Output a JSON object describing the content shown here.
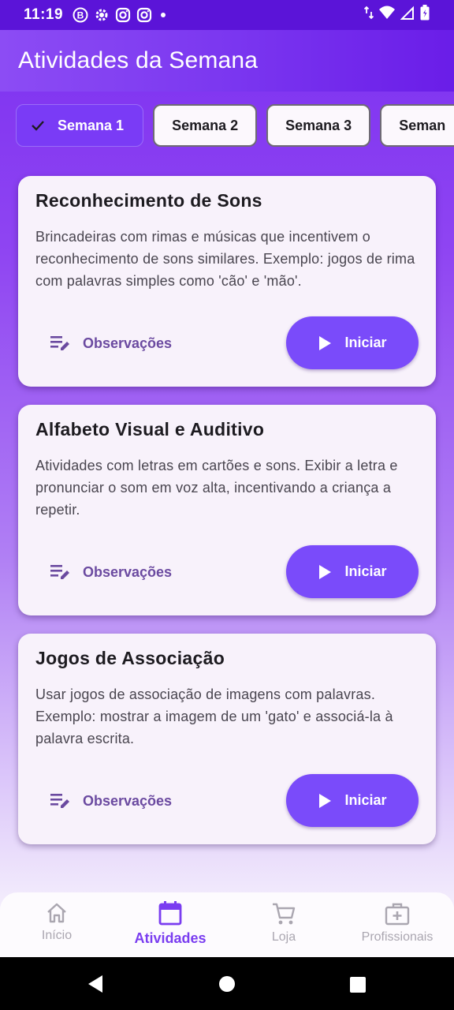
{
  "status_bar": {
    "time": "11:19",
    "icons": [
      "b-circle-icon",
      "settings-gear-icon",
      "instagram-icon",
      "instagram-icon",
      "dot-icon"
    ],
    "right_icons": [
      "data-arrows-icon",
      "wifi-icon",
      "signal-icon",
      "battery-icon"
    ]
  },
  "app_bar": {
    "title": "Atividades da Semana"
  },
  "weeks": [
    {
      "label": "Semana 1",
      "selected": true
    },
    {
      "label": "Semana 2",
      "selected": false
    },
    {
      "label": "Semana 3",
      "selected": false
    },
    {
      "label": "Seman",
      "selected": false
    }
  ],
  "activities": [
    {
      "title": "Reconhecimento de Sons",
      "description": "Brincadeiras com rimas e músicas que incentivem o reconhecimento de sons similares. Exemplo: jogos de rima com palavras simples como 'cão' e 'mão'.",
      "notes_label": "Observações",
      "start_label": "Iniciar"
    },
    {
      "title": "Alfabeto Visual e Auditivo",
      "description": "Atividades com letras em cartões e sons. Exibir a letra e pronunciar o som em voz alta, incentivando a criança a repetir.",
      "notes_label": "Observações",
      "start_label": "Iniciar"
    },
    {
      "title": "Jogos de Associação",
      "description": "Usar jogos de associação de imagens com palavras. Exemplo: mostrar a imagem de um 'gato' e associá-la à palavra escrita.",
      "notes_label": "Observações",
      "start_label": "Iniciar"
    }
  ],
  "bottom_nav": [
    {
      "label": "Início",
      "icon": "home-icon",
      "active": false
    },
    {
      "label": "Atividades",
      "icon": "calendar-icon",
      "active": true
    },
    {
      "label": "Loja",
      "icon": "cart-icon",
      "active": false
    },
    {
      "label": "Profissionais",
      "icon": "medical-kit-icon",
      "active": false
    }
  ],
  "colors": {
    "primary": "#7a4bfa",
    "app_bar": "#7b37f0",
    "status_bar": "#5b14d8",
    "card": "#f8f2fb",
    "nav_active": "#7a3df0",
    "nav_inactive": "#aaa6b0"
  }
}
